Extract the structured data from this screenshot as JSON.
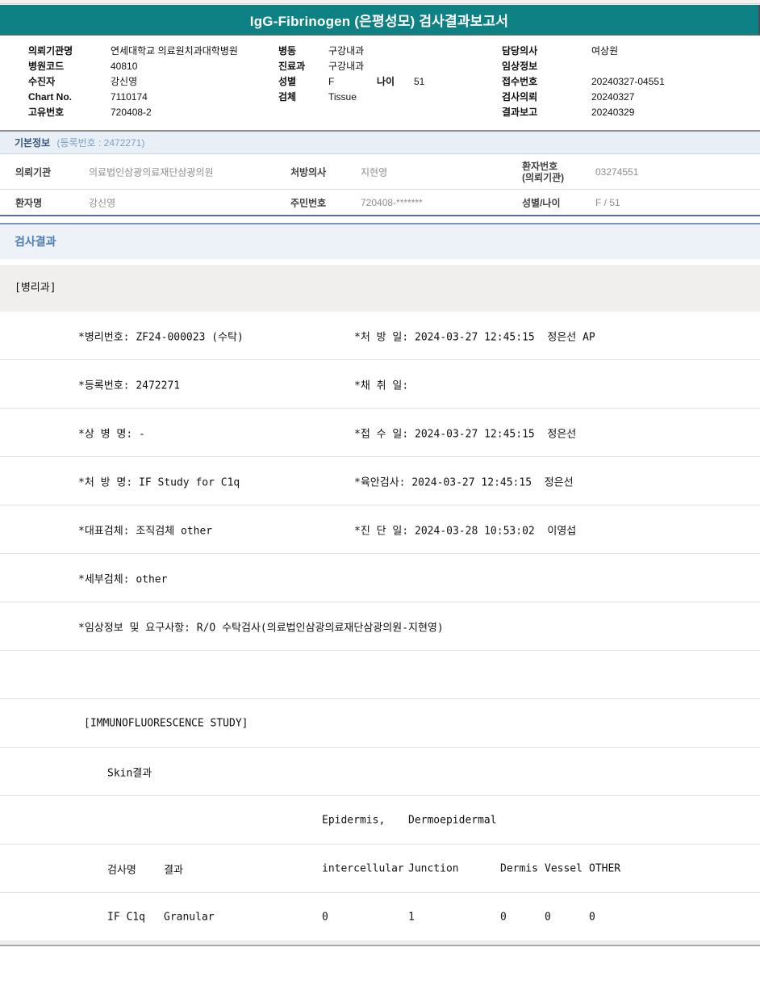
{
  "title_bar": {
    "title": "IgG-Fibrinogen (은평성모) 검사결과보고서"
  },
  "patient_header": {
    "rows": [
      {
        "l1": "의뢰기관명",
        "v1": "연세대학교 의료원치과대학병원",
        "l2": "병동",
        "v2": "구강내과",
        "l3": "담당의사",
        "v3": "여상원"
      },
      {
        "l1": "병원코드",
        "v1": "40810",
        "l2": "진료과",
        "v2": "구강내과",
        "l3": "임상정보",
        "v3": ""
      },
      {
        "l1": "수진자",
        "v1": "강신영",
        "l2": "성별",
        "v2": "F",
        "l2b": "나이",
        "v2b": "51",
        "l3": "접수번호",
        "v3": "20240327-04551"
      },
      {
        "l1": "Chart No.",
        "v1": "7110174",
        "l2": "검체",
        "v2": "Tissue",
        "l3": "검사의뢰",
        "v3": "20240327"
      },
      {
        "l1": "고유번호",
        "v1": "720408-2",
        "l2": "",
        "v2": "",
        "l3": "결과보고",
        "v3": "20240329"
      }
    ]
  },
  "basic_info": {
    "title": "기본정보",
    "reg_no": "(등록번호 : 2472271)",
    "row1": {
      "l1": "의뢰기관",
      "v1": "의료법인삼광의료재단삼광의원",
      "l2": "처방의사",
      "v2": "지현영",
      "l3a": "환자번호",
      "l3b": "(의뢰기관)",
      "v3": "03274551"
    },
    "row2": {
      "l1": "환자명",
      "v1": "강신영",
      "l2": "주민번호",
      "v2": "720408-*******",
      "l3": "성별/나이",
      "v3": "F / 51"
    }
  },
  "results": {
    "section_title": "검사결과",
    "department": "[병리과]",
    "detail_rows": [
      {
        "left": "*병리번호: ZF24-000023 (수탁)",
        "right": "*처 방 일: 2024-03-27 12:45:15  정은선 AP"
      },
      {
        "left": "*등록번호: 2472271",
        "right": "*채 취 일:"
      },
      {
        "left": "*상 병 명: -",
        "right": "*접 수 일: 2024-03-27 12:45:15  정은선"
      },
      {
        "left": "*처 방 명: IF Study for C1q",
        "right": "*육안검사: 2024-03-27 12:45:15  정은선"
      },
      {
        "left": "*대표검체: 조직검체 other",
        "right": "*진 단 일: 2024-03-28 10:53:02  이영섭"
      },
      {
        "left": "*세부검체: other",
        "right": ""
      },
      {
        "left": "*임상정보 및 요구사항: R/O 수탁검사(의료법인삼광의료재단삼광의원-지현영)",
        "right": ""
      }
    ],
    "study_title": "[IMMUNOFLUORESCENCE STUDY]",
    "skin_result_label": "Skin결과",
    "if_table": {
      "group_header": {
        "epidermis": "Epidermis,",
        "dermoepidermal": "Dermoepidermal"
      },
      "columns": {
        "name": "검사명",
        "result": "결과",
        "intercellular": "intercellular",
        "junction": "Junction",
        "dermis": "Dermis",
        "vessel": "Vessel",
        "other": "OTHER"
      },
      "data_row": {
        "name": "IF C1q",
        "result": "Granular",
        "intercellular": "0",
        "junction": "1",
        "dermis": "0",
        "vessel": "0",
        "other": "0"
      }
    }
  },
  "colors": {
    "header_teal": "#0E8184",
    "section_bar_bg": "#EDF2F8",
    "section_title_blue": "#4A7CB8",
    "basic_bar_bg": "#E9EFF6",
    "basic_title_blue": "#39567C",
    "basic_reg_blue": "#7E9FC6",
    "table_bottom_border_blue": "#51719C",
    "department_row_bg": "#F1EFED",
    "value_gray": "#8E8E8E"
  }
}
